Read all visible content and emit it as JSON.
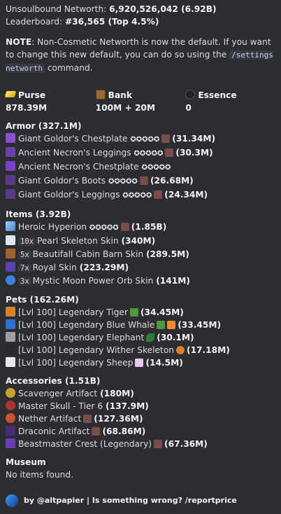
{
  "summary": {
    "networth_label": "Unsoulbound Networth:",
    "networth_value": "6,920,526,042 (6.92B)",
    "leaderboard_label": "Leaderboard:",
    "leaderboard_value": "#36,565 (Top 4.5%)"
  },
  "note": {
    "label": "NOTE",
    "text": ": Non-Cosmetic Networth is now the default. If you want to change this new default, you can do so using the ",
    "command": "/settings networth",
    "tail": " command."
  },
  "fields": [
    {
      "title": "Purse",
      "value": "878.39M",
      "icon": "gold-ingot-icon"
    },
    {
      "title": "Bank",
      "value": "100M + 20M",
      "icon": "chest-icon"
    },
    {
      "title": "Essence",
      "value": "0",
      "icon": "wither-essence-icon"
    }
  ],
  "armor": {
    "title": "Armor (327.1M)",
    "items": [
      {
        "name": "Giant Goldor's Chestplate",
        "stars": "✪✪✪✪✪",
        "value": "(31.34M)"
      },
      {
        "name": "Ancient Necron's Leggings",
        "stars": "✪✪✪✪✪",
        "value": "(30.3M)"
      },
      {
        "name": "Ancient Necron's Chestplate",
        "stars": "✪✪✪✪✪",
        "value": "(27.38M)"
      },
      {
        "name": "Giant Goldor's Boots",
        "stars": "✪✪✪✪✪",
        "value": "(26.68M)"
      },
      {
        "name": "Giant Goldor's Leggings",
        "stars": "✪✪✪✪✪",
        "value": "(24.34M)"
      }
    ]
  },
  "items": {
    "title": "Items (3.92B)",
    "list": [
      {
        "count": "",
        "name": "Heroic Hyperion",
        "stars": "✪✪✪✪✪",
        "value": "(1.85B)"
      },
      {
        "count": "10x",
        "name": "Pearl Skeleton Skin",
        "stars": "",
        "value": "(340M)"
      },
      {
        "count": "5x",
        "name": "Beautifall Cabin Barn Skin",
        "stars": "",
        "value": "(289.5M)"
      },
      {
        "count": "7x",
        "name": "Royal Skin",
        "stars": "",
        "value": "(223.29M)"
      },
      {
        "count": "3x",
        "name": "Mystic Moon Power Orb Skin",
        "stars": "",
        "value": "(141M)"
      }
    ]
  },
  "pets": {
    "title": "Pets (162.26M)",
    "list": [
      {
        "name": "[Lvl 100] Legendary Tiger",
        "value": "(34.45M)"
      },
      {
        "name": "[Lvl 100] Legendary Blue Whale",
        "value": "(33.45M)"
      },
      {
        "name": "[Lvl 100] Legendary Elephant",
        "value": "(30.1M)"
      },
      {
        "name": "[Lvl 100] Legendary Wither Skeleton",
        "value": "(17.18M)"
      },
      {
        "name": "[Lvl 100] Legendary Sheep",
        "value": "(14.5M)"
      }
    ]
  },
  "accessories": {
    "title": "Accessories (1.51B)",
    "list": [
      {
        "name": "Scavenger Artifact",
        "value": "(180M)"
      },
      {
        "name": "Master Skull - Tier 6",
        "value": "(137.9M)"
      },
      {
        "name": "Nether Artifact",
        "value": "(127.36M)"
      },
      {
        "name": "Draconic Artifact",
        "value": "(68.86M)"
      },
      {
        "name": "Beastmaster Crest (Legendary)",
        "value": "(67.36M)"
      }
    ]
  },
  "museum": {
    "title": "Museum",
    "text": "No items found."
  },
  "footer": {
    "text": "by @altpapier | Is something wrong? /reportprice"
  }
}
